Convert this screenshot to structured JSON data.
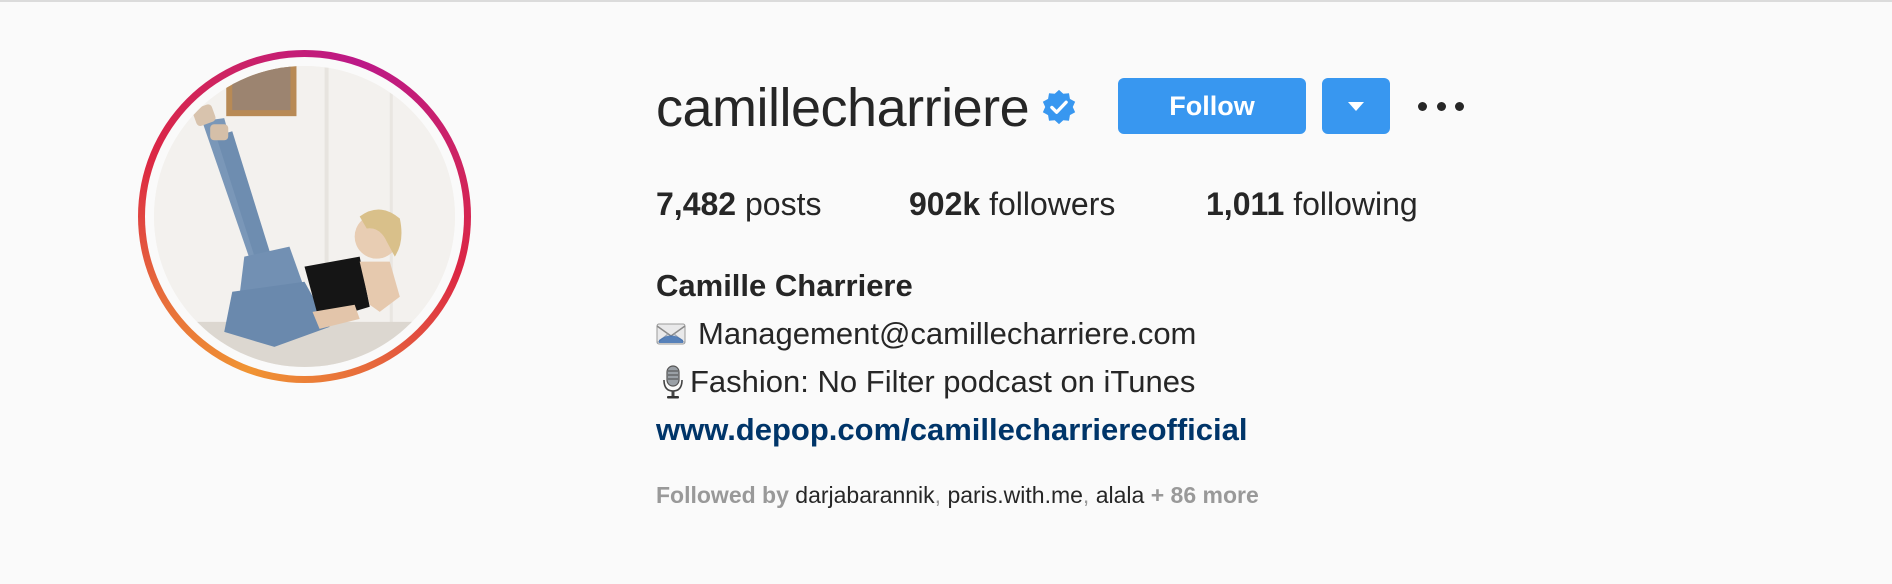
{
  "profile": {
    "username": "camillecharriere",
    "full_name": "Camille Charriere",
    "verified_icon": "verified-badge-icon"
  },
  "actions": {
    "follow_label": "Follow",
    "dropdown_icon": "chevron-down-icon",
    "more_icon": "more-horizontal-icon"
  },
  "stats": {
    "posts": {
      "count": "7,482",
      "label": "posts"
    },
    "followers": {
      "count": "902k",
      "label": "followers"
    },
    "following": {
      "count": "1,011",
      "label": "following"
    }
  },
  "bio": {
    "email_line": "Management@camillecharriere.com",
    "email_icon": "envelope-icon",
    "podcast_line": "Fashion: No Filter podcast on iTunes",
    "podcast_icon": "microphone-icon",
    "website": "www.depop.com/camillecharriereofficial"
  },
  "followed_by": {
    "prefix": "Followed by",
    "accounts": [
      "darjabarannik",
      "paris.with.me",
      "alala"
    ],
    "more": "+ 86 more"
  },
  "colors": {
    "accent": "#3897f0",
    "link": "#003569",
    "muted": "#999999",
    "text": "#262626"
  }
}
